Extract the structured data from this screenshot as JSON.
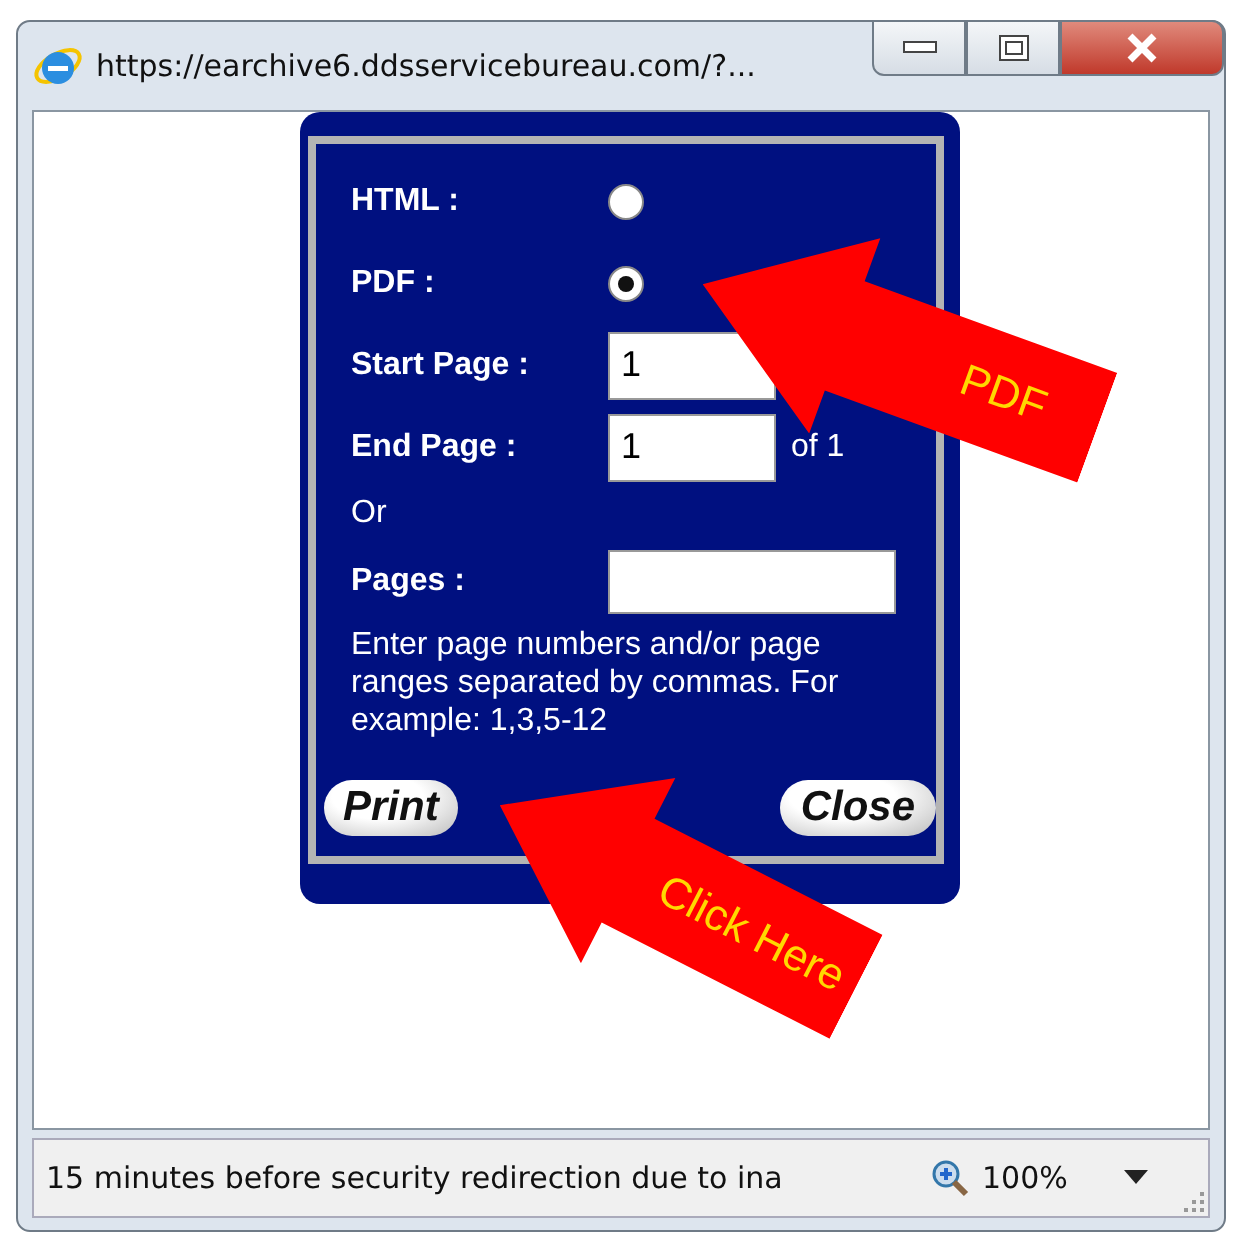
{
  "window": {
    "title": "https://earchive6.ddsservicebureau.com/?..."
  },
  "format_options": [
    {
      "label": "HTML :",
      "selected": false
    },
    {
      "label": "PDF :",
      "selected": true
    }
  ],
  "start_page": {
    "label": "Start Page :",
    "value": "1"
  },
  "end_page": {
    "label": "End Page :",
    "value": "1",
    "suffix": "of 1"
  },
  "or_text": "Or",
  "pages": {
    "label": "Pages :"
  },
  "help_text": "Enter page numbers and/or page ranges separated by commas. For example: 1,3,5-12",
  "buttons": [
    "Print",
    "Close"
  ],
  "callouts": [
    {
      "label": "PDF"
    },
    {
      "label": "Click Here"
    }
  ],
  "status_bar": {
    "message": "15 minutes before security redirection due to ina",
    "zoom": "100%"
  }
}
